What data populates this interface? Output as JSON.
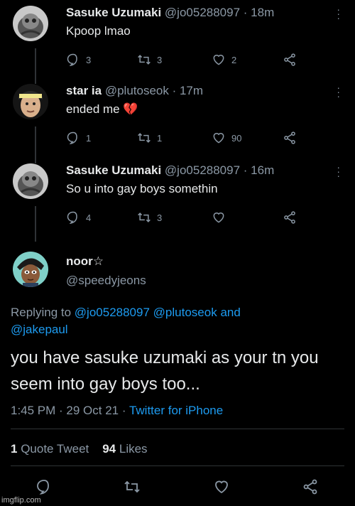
{
  "tweets": [
    {
      "name": "Sasuke Uzumaki",
      "handle": "@jo05288097 · 18m",
      "text": "Kpoop lmao",
      "replies": "3",
      "retweets": "3",
      "likes": "2"
    },
    {
      "name": "star ia",
      "handle": "@plutoseok · 17m",
      "text": "ended me 💔",
      "replies": "1",
      "retweets": "1",
      "likes": "90"
    },
    {
      "name": "Sasuke Uzumaki",
      "handle": "@jo05288097 · 16m",
      "text": "So u into gay boys somethin",
      "replies": "4",
      "retweets": "3",
      "likes": ""
    }
  ],
  "main": {
    "name": "noor☆",
    "handle": "@speedyjeons",
    "replying_prefix": "Replying to",
    "mention1": "@jo05288097",
    "mention2": "@plutoseok",
    "and": "and",
    "mention3": "@jakepaul",
    "text": "you have sasuke uzumaki as your tn you seem into gay boys too...",
    "time": "1:45 PM · 29 Oct 21 ·",
    "client": "Twitter for iPhone",
    "quote_count": "1",
    "quote_label": "Quote Tweet",
    "likes_count": "94",
    "likes_label": "Likes"
  },
  "watermark": "imgflip.com",
  "colors": {
    "background": "#000000",
    "link": "#1d9bf0",
    "muted": "#8b98a5",
    "text": "#e7e9ea",
    "heart": "#e0245e"
  },
  "icons": [
    "reply-icon",
    "retweet-icon",
    "like-icon",
    "share-icon",
    "more-icon"
  ]
}
